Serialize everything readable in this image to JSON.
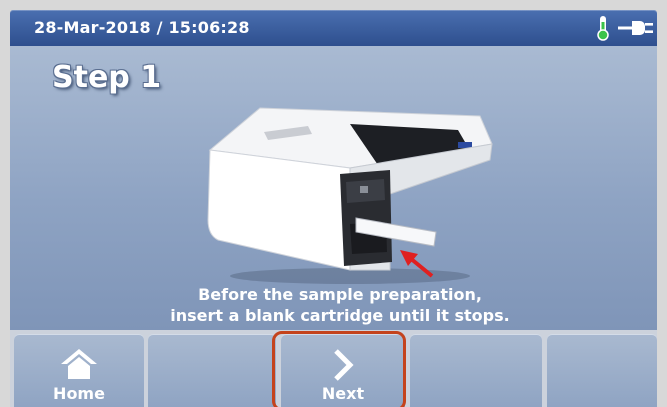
{
  "status_bar": {
    "datetime": "28-Mar-2018 / 15:06:28",
    "icons": [
      "thermometer-icon",
      "power-plug-icon"
    ]
  },
  "main": {
    "title": "Step 1",
    "instruction_line1": "Before the sample preparation,",
    "instruction_line2": "insert a blank cartridge until it stops."
  },
  "nav": {
    "home_label": "Home",
    "next_label": "Next"
  },
  "colors": {
    "header": "#2e4f8e",
    "thermometer": "#3cc34a",
    "arrow": "#e02020",
    "highlight": "#c4431c"
  }
}
